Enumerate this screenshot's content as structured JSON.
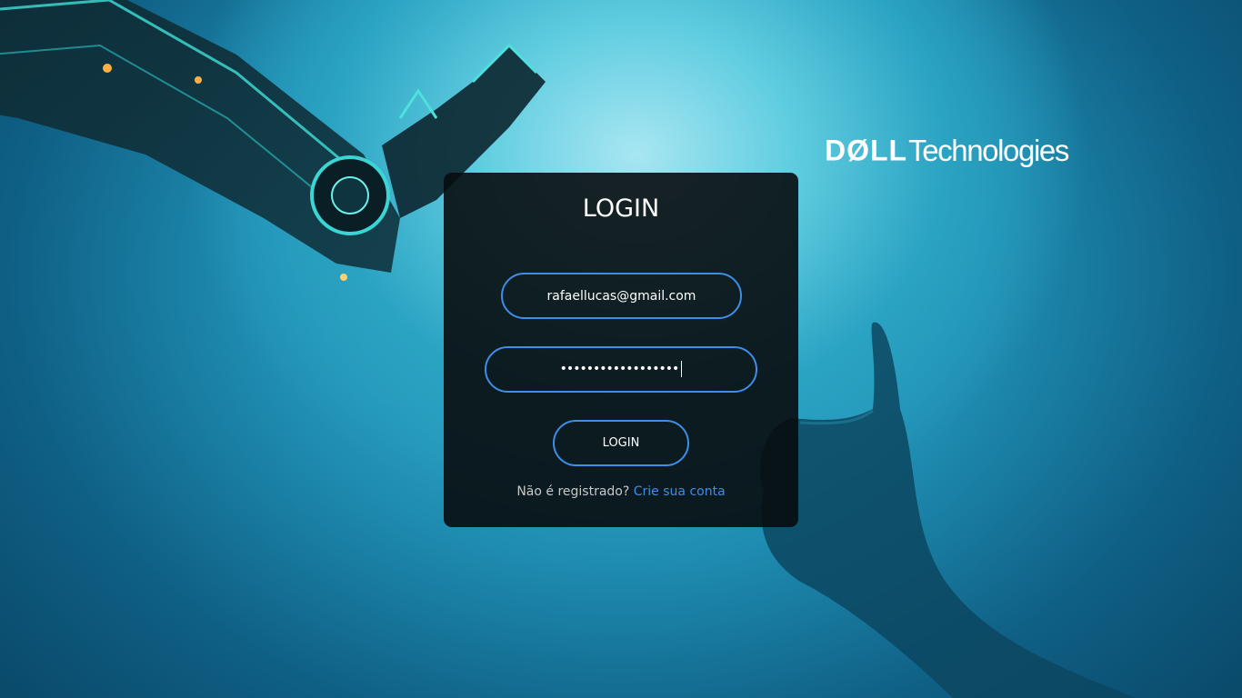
{
  "brand": {
    "logo_dell": "DØLL",
    "logo_technologies": "Technologies"
  },
  "login": {
    "title": "LOGIN",
    "email_value": "rafaellucas@gmail.com",
    "password_value": "••••••••••••••••••",
    "button_label": "LOGIN",
    "register_prompt": "Não é registrado?",
    "register_link": "Crie sua conta"
  },
  "colors": {
    "accent": "#3e8de8",
    "card_bg": "#080c0e",
    "background": "#1f8db2"
  }
}
